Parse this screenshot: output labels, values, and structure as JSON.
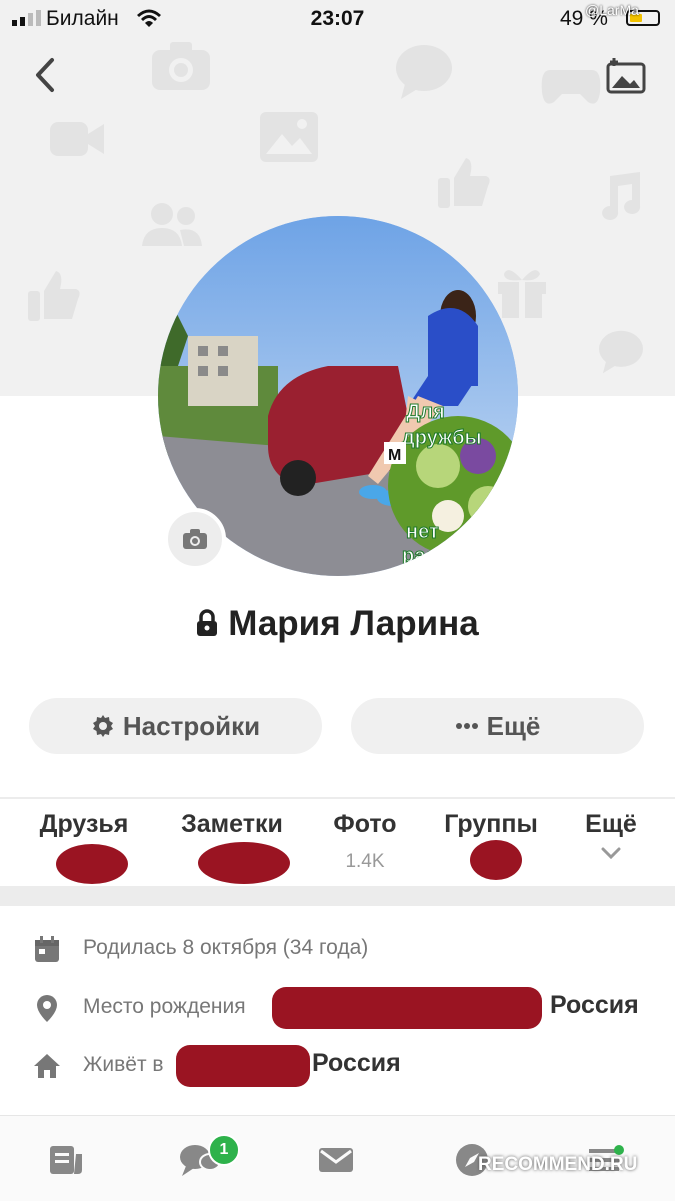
{
  "status_bar": {
    "carrier": "Билайн",
    "time": "23:07",
    "battery": "49 %",
    "watermark": "@LarMa"
  },
  "profile": {
    "name": "Мария Ларина",
    "avatar_sticker": [
      "Для",
      "дружбы",
      "нет",
      "расстояний"
    ],
    "plate": "М"
  },
  "actions": {
    "settings_label": "Настройки",
    "more_label": "Ещё"
  },
  "tabs": [
    {
      "label": "Друзья",
      "count": ""
    },
    {
      "label": "Заметки",
      "count": ""
    },
    {
      "label": "Фото",
      "count": "1.4K"
    },
    {
      "label": "Группы",
      "count": ""
    },
    {
      "label": "Ещё",
      "count": ""
    }
  ],
  "info": {
    "birthday": "Родилась 8 октября (34 года)",
    "birthplace_label": "Место рождения",
    "birthplace_country": "Россия",
    "lives_label": "Живёт в",
    "lives_country": "Россия"
  },
  "bottom_nav": {
    "messages_badge": "1"
  },
  "site_watermark": "RECOMMEND.RU",
  "colors": {
    "accent_green": "#2eb24b",
    "redaction": "#9a1422",
    "cover_bg": "#f1f1f1"
  }
}
